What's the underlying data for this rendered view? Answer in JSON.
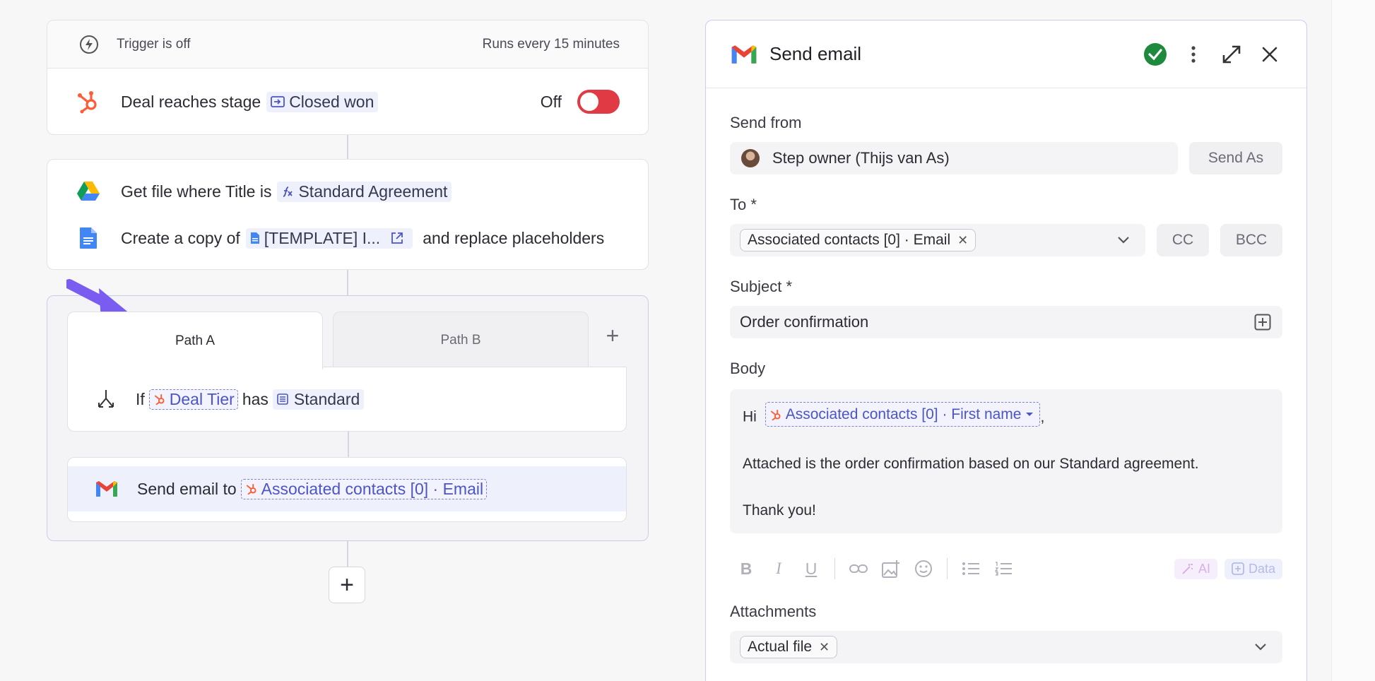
{
  "workflow": {
    "trigger": {
      "status": "Trigger is off",
      "schedule": "Runs every 15 minutes",
      "event_text": "Deal reaches stage",
      "stage_chip": "Closed won",
      "toggle_label": "Off",
      "toggle_on": false
    },
    "get_file": {
      "text": "Get file where Title is",
      "chip": "Standard Agreement"
    },
    "copy_file": {
      "text": "Create a copy of",
      "chip": "[TEMPLATE] I...",
      "after": "and replace placeholders"
    },
    "paths": {
      "tabs": [
        {
          "label": "Path A",
          "active": true
        },
        {
          "label": "Path B",
          "active": false
        }
      ],
      "add_label": "+",
      "condition": {
        "if": "If",
        "field": "Deal Tier",
        "op": "has",
        "value": "Standard"
      },
      "send": {
        "text": "Send email to",
        "recipient": "Associated contacts [0] · Email"
      }
    },
    "add_step_label": "+"
  },
  "panel": {
    "title": "Send email",
    "send_from": {
      "label": "Send from",
      "value": "Step owner (Thijs van As)",
      "send_as": "Send As"
    },
    "to": {
      "label": "To *",
      "tag": "Associated contacts [0] · Email",
      "cc": "CC",
      "bcc": "BCC"
    },
    "subject": {
      "label": "Subject *",
      "value": "Order confirmation"
    },
    "body": {
      "label": "Body",
      "greeting": "Hi",
      "var": "Associated contacts [0] · First name",
      "comma": ",",
      "line2": "Attached is the order confirmation based on our Standard agreement.",
      "line3": "Thank you!"
    },
    "toolbar": {
      "ai": "AI",
      "data": "Data"
    },
    "attachments": {
      "label": "Attachments",
      "tag": "Actual file"
    }
  },
  "colors": {
    "accent": "#4b55c8",
    "toggle_off": "#e03a45",
    "success": "#1e8a3e",
    "hubspot": "#ff5c35",
    "arrow": "#7b5cf0"
  }
}
